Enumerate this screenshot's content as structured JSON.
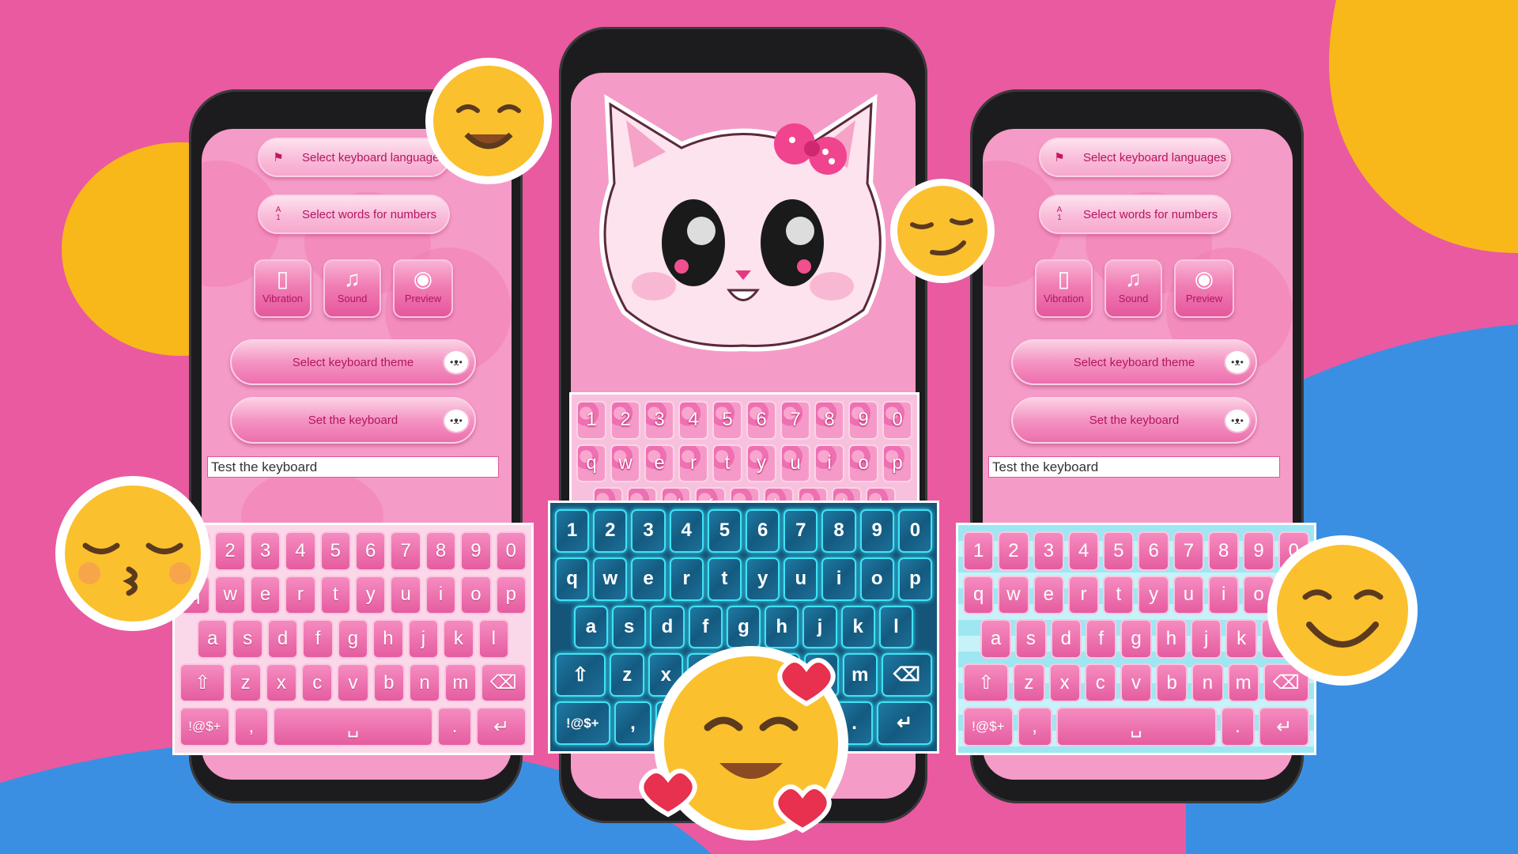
{
  "colors": {
    "background": "#ea5aa0",
    "yellow": "#f9b81a",
    "blue": "#3b8fe2",
    "pink_text": "#b3155f",
    "cyan_glow": "#3ee3f7"
  },
  "menu": {
    "languages": {
      "label": "Select keyboard languages",
      "icon": "flag-icon"
    },
    "numbers": {
      "label": "Select words for numbers",
      "icon": "a1-icon"
    },
    "vibration": {
      "label": "Vibration",
      "icon": "vibration-icon"
    },
    "sound": {
      "label": "Sound",
      "icon": "music-note-icon"
    },
    "preview": {
      "label": "Preview",
      "icon": "eye-icon"
    },
    "theme": {
      "label": "Select keyboard theme",
      "icon": "kitty-icon"
    },
    "set": {
      "label": "Set the keyboard",
      "icon": "kitty-icon"
    },
    "test_input": {
      "value": "Test the keyboard"
    }
  },
  "keyboard": {
    "rows": [
      [
        "1",
        "2",
        "3",
        "4",
        "5",
        "6",
        "7",
        "8",
        "9",
        "0"
      ],
      [
        "q",
        "w",
        "e",
        "r",
        "t",
        "y",
        "u",
        "i",
        "o",
        "p"
      ],
      [
        "a",
        "s",
        "d",
        "f",
        "g",
        "h",
        "j",
        "k",
        "l"
      ],
      [
        "⇧",
        "z",
        "x",
        "c",
        "v",
        "b",
        "n",
        "m",
        "⌫"
      ],
      [
        "!@$+",
        ",",
        "␣",
        ".",
        "↵"
      ]
    ],
    "themes": [
      "pink",
      "blue",
      "cyan",
      "pink-pattern"
    ]
  }
}
